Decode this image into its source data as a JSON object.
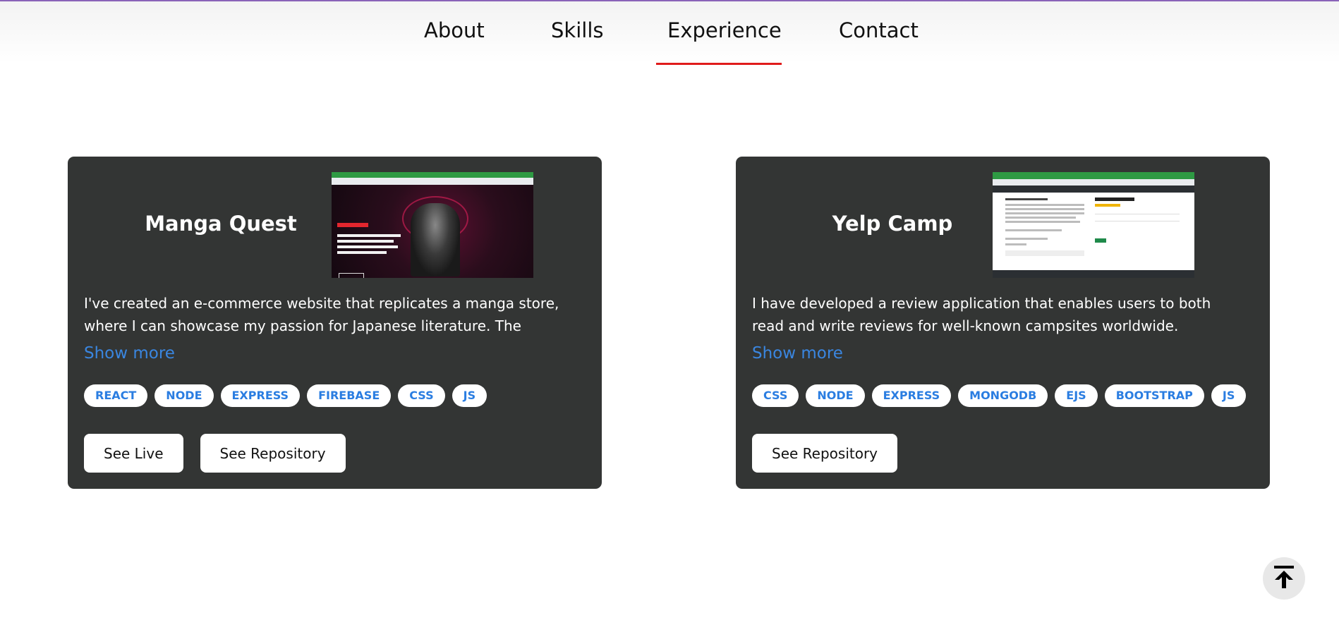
{
  "nav": {
    "items": [
      {
        "label": "About"
      },
      {
        "label": "Skills"
      },
      {
        "label": "Experience"
      },
      {
        "label": "Contact"
      }
    ],
    "active": "Experience"
  },
  "projects": [
    {
      "title": "Manga Quest",
      "screenshot_icon": "manga-store-screenshot",
      "description": "I've created an e-commerce website that replicates a manga store, where I can showcase my passion for Japanese literature. The website was developed using React, Node/Express, and Firebase as the tech stack.",
      "show_more": "Show more",
      "tags": [
        "REACT",
        "NODE",
        "EXPRESS",
        "FIREBASE",
        "CSS",
        "JS"
      ],
      "buttons": [
        "See Live",
        "See Repository"
      ]
    },
    {
      "title": "Yelp Camp",
      "screenshot_icon": "yelp-camp-screenshot",
      "description": "I have developed a review application that enables users to both read and write reviews for well-known campsites worldwide. Node.js/Express for the back-end and MongoDB as the database. EJS templates were used to serve",
      "show_more": "Show more",
      "tags": [
        "CSS",
        "NODE",
        "EXPRESS",
        "MONGODB",
        "EJS",
        "BOOTSTRAP",
        "JS"
      ],
      "buttons": [
        "See Repository"
      ]
    }
  ],
  "colors": {
    "accent_underline": "#e01b1b",
    "card_bg": "#333534",
    "tag_text": "#2a7de1",
    "show_more": "#3a86e0"
  },
  "scroll_top_icon": "arrow-up-to-line-icon"
}
